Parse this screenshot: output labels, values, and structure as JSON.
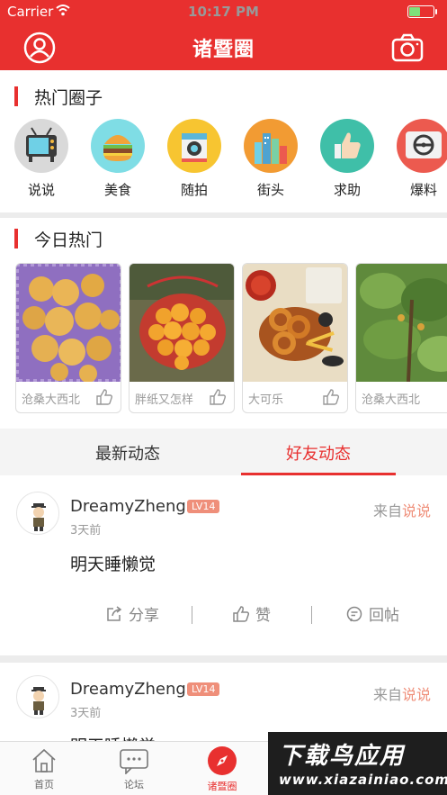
{
  "status_bar": {
    "carrier": "Carrier",
    "time": "10:17 PM"
  },
  "nav": {
    "title": "诸暨圈"
  },
  "hot_circles": {
    "title": "热门圈子",
    "items": [
      {
        "label": "说说",
        "icon": "tv-icon"
      },
      {
        "label": "美食",
        "icon": "burger-icon"
      },
      {
        "label": "随拍",
        "icon": "camera-icon"
      },
      {
        "label": "街头",
        "icon": "city-icon"
      },
      {
        "label": "求助",
        "icon": "thumbs-up-icon"
      },
      {
        "label": "爆料",
        "icon": "steering-icon"
      }
    ]
  },
  "today_hot": {
    "title": "今日热门",
    "cards": [
      {
        "caption": "沧桑大西北",
        "image": "loquat-basket-photo"
      },
      {
        "caption": "胖纸又怎样",
        "image": "loquat-bucket-photo"
      },
      {
        "caption": "大可乐",
        "image": "fried-food-photo"
      },
      {
        "caption": "沧桑大西北",
        "image": "tree-photo"
      }
    ]
  },
  "feed_tabs": {
    "latest": "最新动态",
    "friends": "好友动态",
    "active": "friends"
  },
  "posts": [
    {
      "username": "DreamyZheng",
      "level": "LV14",
      "time": "3天前",
      "from_prefix": "来自",
      "from_source": "说说",
      "content": "明天睡懒觉",
      "share": "分享",
      "like": "赞",
      "reply": "回帖"
    },
    {
      "username": "DreamyZheng",
      "level": "LV14",
      "time": "3天前",
      "from_prefix": "来自",
      "from_source": "说说",
      "content": "明天睡懒觉"
    }
  ],
  "tabbar": {
    "items": [
      {
        "label": "首页",
        "icon": "home-icon"
      },
      {
        "label": "论坛",
        "icon": "forum-icon"
      },
      {
        "label": "诸暨圈",
        "icon": "compass-icon"
      }
    ]
  },
  "watermark": {
    "line1": "下载鸟应用",
    "line2": "www.xiazainiao.com"
  },
  "colors": {
    "brand": "#e8302f",
    "level_badge": "#ef8f7a"
  }
}
